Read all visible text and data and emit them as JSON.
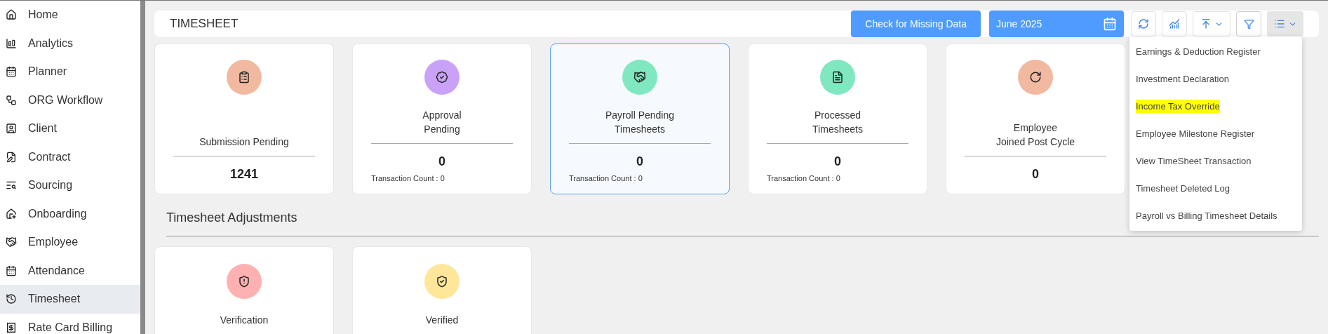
{
  "sidebar": {
    "items": [
      {
        "label": "Home",
        "selected": false
      },
      {
        "label": "Analytics",
        "selected": false
      },
      {
        "label": "Planner",
        "selected": false
      },
      {
        "label": "ORG Workflow",
        "selected": false
      },
      {
        "label": "Client",
        "selected": false
      },
      {
        "label": "Contract",
        "selected": false
      },
      {
        "label": "Sourcing",
        "selected": false
      },
      {
        "label": "Onboarding",
        "selected": false
      },
      {
        "label": "Employee",
        "selected": false
      },
      {
        "label": "Attendance",
        "selected": false
      },
      {
        "label": "Timesheet",
        "selected": true
      },
      {
        "label": "Rate Card Billing",
        "selected": false
      }
    ]
  },
  "header": {
    "title": "TIMESHEET",
    "check_button": "Check for Missing Data",
    "month_field": {
      "value": "June 2025"
    }
  },
  "menu": {
    "items": [
      {
        "label": "Earnings & Deduction Register",
        "highlighted": false
      },
      {
        "label": "Investment Declaration",
        "highlighted": false
      },
      {
        "label": "Income Tax Override",
        "highlighted": true
      },
      {
        "label": "Employee Milestone Register",
        "highlighted": false
      },
      {
        "label": "View TimeSheet Transaction",
        "highlighted": false
      },
      {
        "label": "Timesheet Deleted Log",
        "highlighted": false
      },
      {
        "label": "Payroll vs Billing Timesheet Details",
        "highlighted": false
      }
    ]
  },
  "cards": [
    {
      "title_lines": [
        "Submission Pending"
      ],
      "value": "1241",
      "color": "#f0b9a0",
      "selected": false
    },
    {
      "title_lines": [
        "Approval",
        "Pending"
      ],
      "value": "0",
      "transaction_count": "Transaction Count : 0",
      "color": "#c9a2f8",
      "selected": false
    },
    {
      "title_lines": [
        "Payroll Pending",
        "Timesheets"
      ],
      "value": "0",
      "transaction_count": "Transaction Count : 0",
      "color": "#80e8c0",
      "selected": true
    },
    {
      "title_lines": [
        "Processed",
        "Timesheets"
      ],
      "value": "0",
      "transaction_count": "Transaction Count : 0",
      "color": "#80e8c0",
      "selected": false
    },
    {
      "title_lines": [
        "Employee",
        "Joined Post Cycle"
      ],
      "value": "0",
      "color": "#f0b9a0",
      "selected": false
    }
  ],
  "adjustments": {
    "title": "Timesheet Adjustments",
    "cards": [
      {
        "title": "Verification",
        "color": "#ffb0b0"
      },
      {
        "title": "Verified",
        "color": "#ffe699"
      }
    ]
  }
}
